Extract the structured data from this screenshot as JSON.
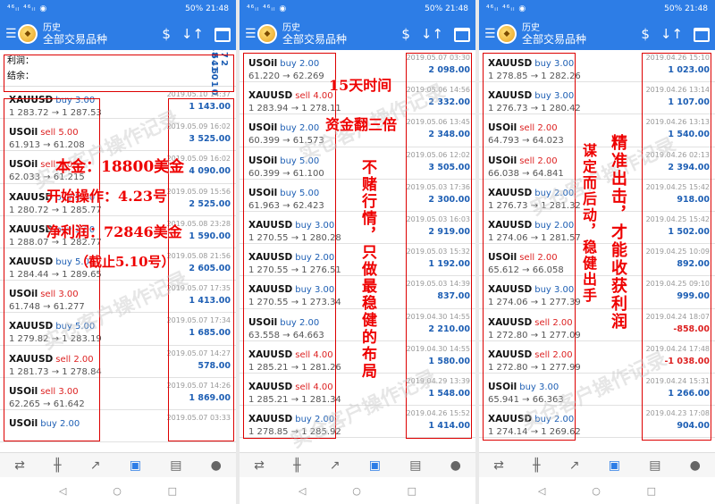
{
  "status": {
    "left": "⁴⁶ᵢₗ ⁴⁶ᵢₗ ◉",
    "battery": "50%",
    "time": "21:48"
  },
  "header": {
    "title_small": "历史",
    "title": "全部交易品种",
    "icon_currency": "$",
    "icon_sort": "↓↑"
  },
  "summary": {
    "profit_label": "利润：",
    "profit_value": "72 846.10",
    "balance_label": "结余：",
    "balance_value": "72 846.10"
  },
  "phones": [
    {
      "rows": [
        {
          "sym": "XAUUSD",
          "side": "buy 3.00",
          "type": "buy",
          "price": "1 283.72 → 1 287.53",
          "date": "2019.05.10 14:37",
          "profit": "1 143.00"
        },
        {
          "sym": "USOil",
          "side": "sell 5.00",
          "type": "sell",
          "price": "61.913 → 61.208",
          "date": "2019.05.09 16:02",
          "profit": "3 525.00"
        },
        {
          "sym": "USOil",
          "side": "sell 5.00",
          "type": "sell",
          "price": "62.033 → 61.215",
          "date": "2019.05.09 16:02",
          "profit": "4 090.00"
        },
        {
          "sym": "XAUUSD",
          "side": "buy 5.00",
          "type": "buy",
          "price": "1 280.72 → 1 285.77",
          "date": "2019.05.09 15:56",
          "profit": "2 525.00"
        },
        {
          "sym": "XAUUSD",
          "side": "buy 3.00",
          "type": "buy",
          "price": "1 288.07 → 1 282.77",
          "date": "2019.05.08 23:28",
          "profit": "1 590.00"
        },
        {
          "sym": "XAUUSD",
          "side": "buy 5.00",
          "type": "buy",
          "price": "1 284.44 → 1 289.65",
          "date": "2019.05.08 21:56",
          "profit": "2 605.00"
        },
        {
          "sym": "USOil",
          "side": "sell 3.00",
          "type": "sell",
          "price": "61.748 → 61.277",
          "date": "2019.05.07 17:35",
          "profit": "1 413.00"
        },
        {
          "sym": "XAUUSD",
          "side": "buy 5.00",
          "type": "buy",
          "price": "1 279.82 → 1 283.19",
          "date": "2019.05.07 17:34",
          "profit": "1 685.00"
        },
        {
          "sym": "XAUUSD",
          "side": "sell 2.00",
          "type": "sell",
          "price": "1 281.73 → 1 278.84",
          "date": "2019.05.07 14:27",
          "profit": "578.00"
        },
        {
          "sym": "USOil",
          "side": "sell 3.00",
          "type": "sell",
          "price": "62.265 → 61.642",
          "date": "2019.05.07 14:26",
          "profit": "1 869.00"
        },
        {
          "sym": "USOil",
          "side": "buy 2.00",
          "type": "buy",
          "price": "",
          "date": "2019.05.07 03:33",
          "profit": ""
        }
      ]
    },
    {
      "rows": [
        {
          "sym": "USOil",
          "side": "buy 2.00",
          "type": "buy",
          "price": "61.220 → 62.269",
          "date": "2019.05.07 03:30",
          "profit": "2 098.00"
        },
        {
          "sym": "XAUUSD",
          "side": "sell 4.00",
          "type": "sell",
          "price": "1 283.94 → 1 278.11",
          "date": "2019.05.06 14:56",
          "profit": "2 332.00"
        },
        {
          "sym": "USOil",
          "side": "buy 2.00",
          "type": "buy",
          "price": "60.399 → 61.573",
          "date": "2019.05.06 13:45",
          "profit": "2 348.00"
        },
        {
          "sym": "USOil",
          "side": "buy 5.00",
          "type": "buy",
          "price": "60.399 → 61.100",
          "date": "2019.05.06 12:02",
          "profit": "3 505.00"
        },
        {
          "sym": "USOil",
          "side": "buy 5.00",
          "type": "buy",
          "price": "61.963 → 62.423",
          "date": "2019.05.03 17:36",
          "profit": "2 300.00"
        },
        {
          "sym": "XAUUSD",
          "side": "buy 3.00",
          "type": "buy",
          "price": "1 270.55 → 1 280.28",
          "date": "2019.05.03 16:03",
          "profit": "2 919.00"
        },
        {
          "sym": "XAUUSD",
          "side": "buy 2.00",
          "type": "buy",
          "price": "1 270.55 → 1 276.51",
          "date": "2019.05.03 15:32",
          "profit": "1 192.00"
        },
        {
          "sym": "XAUUSD",
          "side": "buy 3.00",
          "type": "buy",
          "price": "1 270.55 → 1 273.34",
          "date": "2019.05.03 14:39",
          "profit": "837.00"
        },
        {
          "sym": "USOil",
          "side": "buy 2.00",
          "type": "buy",
          "price": "63.558 → 64.663",
          "date": "2019.04.30 14:55",
          "profit": "2 210.00"
        },
        {
          "sym": "XAUUSD",
          "side": "sell 4.00",
          "type": "sell",
          "price": "1 285.21 → 1 281.26",
          "date": "2019.04.30 14:55",
          "profit": "1 580.00"
        },
        {
          "sym": "XAUUSD",
          "side": "sell 4.00",
          "type": "sell",
          "price": "1 285.21 → 1 281.34",
          "date": "2019.04.29 13:39",
          "profit": "1 548.00"
        },
        {
          "sym": "XAUUSD",
          "side": "buy 2.00",
          "type": "buy",
          "price": "1 278.85 → 1 285.92",
          "date": "2019.04.26 15:52",
          "profit": "1 414.00"
        }
      ]
    },
    {
      "rows": [
        {
          "sym": "XAUUSD",
          "side": "buy 3.00",
          "type": "buy",
          "price": "1 278.85 → 1 282.26",
          "date": "2019.04.26 15:10",
          "profit": "1 023.00"
        },
        {
          "sym": "XAUUSD",
          "side": "buy 3.00",
          "type": "buy",
          "price": "1 276.73 → 1 280.42",
          "date": "2019.04.26 13:14",
          "profit": "1 107.00"
        },
        {
          "sym": "USOil",
          "side": "sell 2.00",
          "type": "sell",
          "price": "64.793 → 64.023",
          "date": "2019.04.26 13:13",
          "profit": "1 540.00"
        },
        {
          "sym": "USOil",
          "side": "sell 2.00",
          "type": "sell",
          "price": "66.038 → 64.841",
          "date": "2019.04.26 02:13",
          "profit": "2 394.00"
        },
        {
          "sym": "XAUUSD",
          "side": "buy 2.00",
          "type": "buy",
          "price": "1 276.73 → 1 281.32",
          "date": "2019.04.25 15:42",
          "profit": "918.00"
        },
        {
          "sym": "XAUUSD",
          "side": "buy 2.00",
          "type": "buy",
          "price": "1 274.06 → 1 281.57",
          "date": "2019.04.25 15:42",
          "profit": "1 502.00"
        },
        {
          "sym": "USOil",
          "side": "sell 2.00",
          "type": "sell",
          "price": "65.612 → 66.058",
          "date": "2019.04.25 10:09",
          "profit": "892.00"
        },
        {
          "sym": "XAUUSD",
          "side": "buy 3.00",
          "type": "buy",
          "price": "1 274.06 → 1 277.39",
          "date": "2019.04.25 09:10",
          "profit": "999.00"
        },
        {
          "sym": "XAUUSD",
          "side": "sell 2.00",
          "type": "sell",
          "price": "1 272.80 → 1 277.09",
          "date": "2019.04.24 18:07",
          "profit": "-858.00"
        },
        {
          "sym": "XAUUSD",
          "side": "sell 2.00",
          "type": "sell",
          "price": "1 272.80 → 1 277.99",
          "date": "2019.04.24 17:48",
          "profit": "-1 038.00"
        },
        {
          "sym": "USOil",
          "side": "buy 3.00",
          "type": "buy",
          "price": "65.941 → 66.363",
          "date": "2019.04.24 15:31",
          "profit": "1 266.00"
        },
        {
          "sym": "XAUUSD",
          "side": "buy 2.00",
          "type": "buy",
          "price": "1 274.14 → 1 269.62",
          "date": "2019.04.23 17:08",
          "profit": "904.00"
        }
      ]
    }
  ],
  "annotations": {
    "a1": "本金：18800美金",
    "a2": "开始操作：4.23号",
    "a3": "净利润：72846美金",
    "a4": "（截止5.10号）",
    "b1": "15天时间",
    "b2": "资金翻三倍",
    "b3": "不赌行情，只做最稳健的布局",
    "c1": "谋定而后动，稳健出手",
    "c2": "精准出击，才能收获利润"
  },
  "watermarks": [
    "实仓客户操作记录",
    "实仓客户操作记录",
    "实仓客户操作记录"
  ],
  "nav": {
    "back": "◁",
    "home": "○",
    "recent": "□"
  }
}
